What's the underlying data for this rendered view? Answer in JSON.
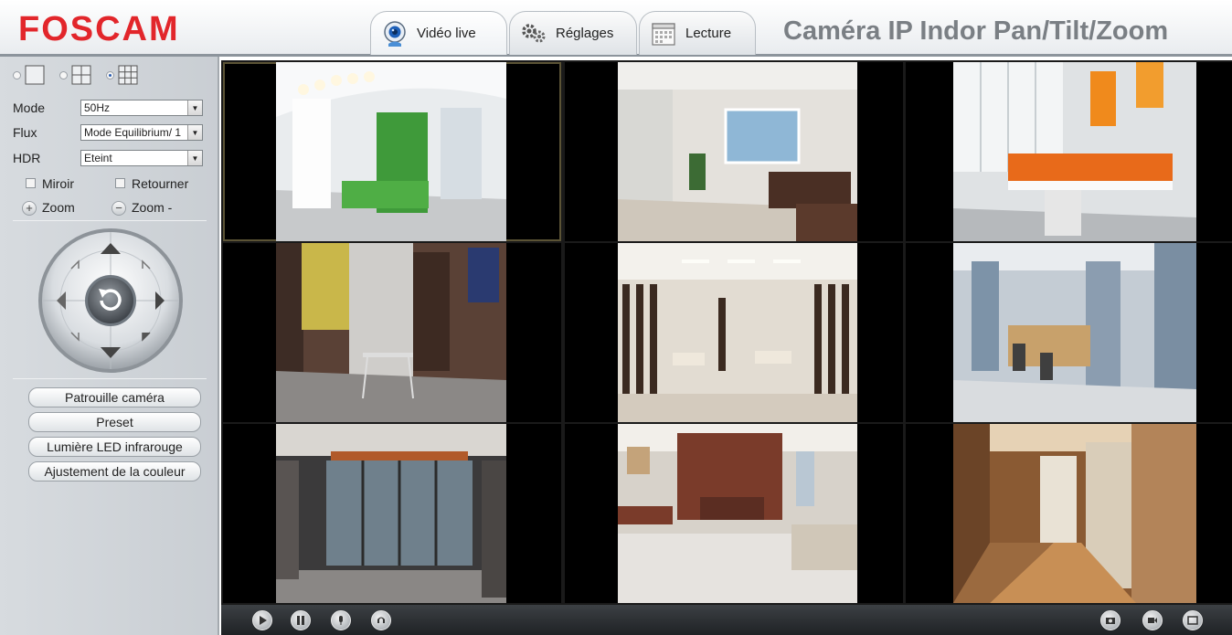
{
  "header": {
    "logo": "FOSCAM",
    "title": "Caméra IP Indor Pan/Tilt/Zoom",
    "tabs": [
      {
        "label": "Vidéo live",
        "icon": "webcam-icon",
        "active": true
      },
      {
        "label": "Réglages",
        "icon": "gears-icon",
        "active": false
      },
      {
        "label": "Lecture",
        "icon": "calendar-icon",
        "active": false
      }
    ]
  },
  "sidebar": {
    "layouts": [
      {
        "icon": "single-view-icon",
        "selected": false
      },
      {
        "icon": "quad-view-icon",
        "selected": false
      },
      {
        "icon": "nine-view-icon",
        "selected": true
      }
    ],
    "mode": {
      "label": "Mode",
      "value": "50Hz"
    },
    "flux": {
      "label": "Flux",
      "value": "Mode Equilibrium/ 1"
    },
    "hdr": {
      "label": "HDR",
      "value": "Eteint"
    },
    "mirror": {
      "label": "Miroir",
      "checked": false
    },
    "flip": {
      "label": "Retourner",
      "checked": false
    },
    "zoom_in": {
      "symbol": "+",
      "label": "Zoom"
    },
    "zoom_out": {
      "symbol": "−",
      "label": "Zoom -"
    },
    "buttons": {
      "patrol": "Patrouille caméra",
      "preset": "Preset",
      "ir_led": "Lumière LED infrarouge",
      "color": "Ajustement de la couleur"
    }
  },
  "video": {
    "selected_cell": 1,
    "cells": [
      {
        "scene": "office-green-lounge"
      },
      {
        "scene": "office-window-desk"
      },
      {
        "scene": "office-orange-workstations"
      },
      {
        "scene": "office-artwork-desk"
      },
      {
        "scene": "lobby-wood-pillars"
      },
      {
        "scene": "reception-blue-columns"
      },
      {
        "scene": "glass-meeting-room"
      },
      {
        "scene": "executive-office"
      },
      {
        "scene": "hallway-glass-doors"
      }
    ]
  },
  "bottom_bar": {
    "left_icons": [
      "play-icon",
      "stop-icon",
      "talk-icon",
      "listen-icon"
    ],
    "right_icons": [
      "snapshot-icon",
      "record-icon",
      "fullscreen-icon"
    ]
  }
}
